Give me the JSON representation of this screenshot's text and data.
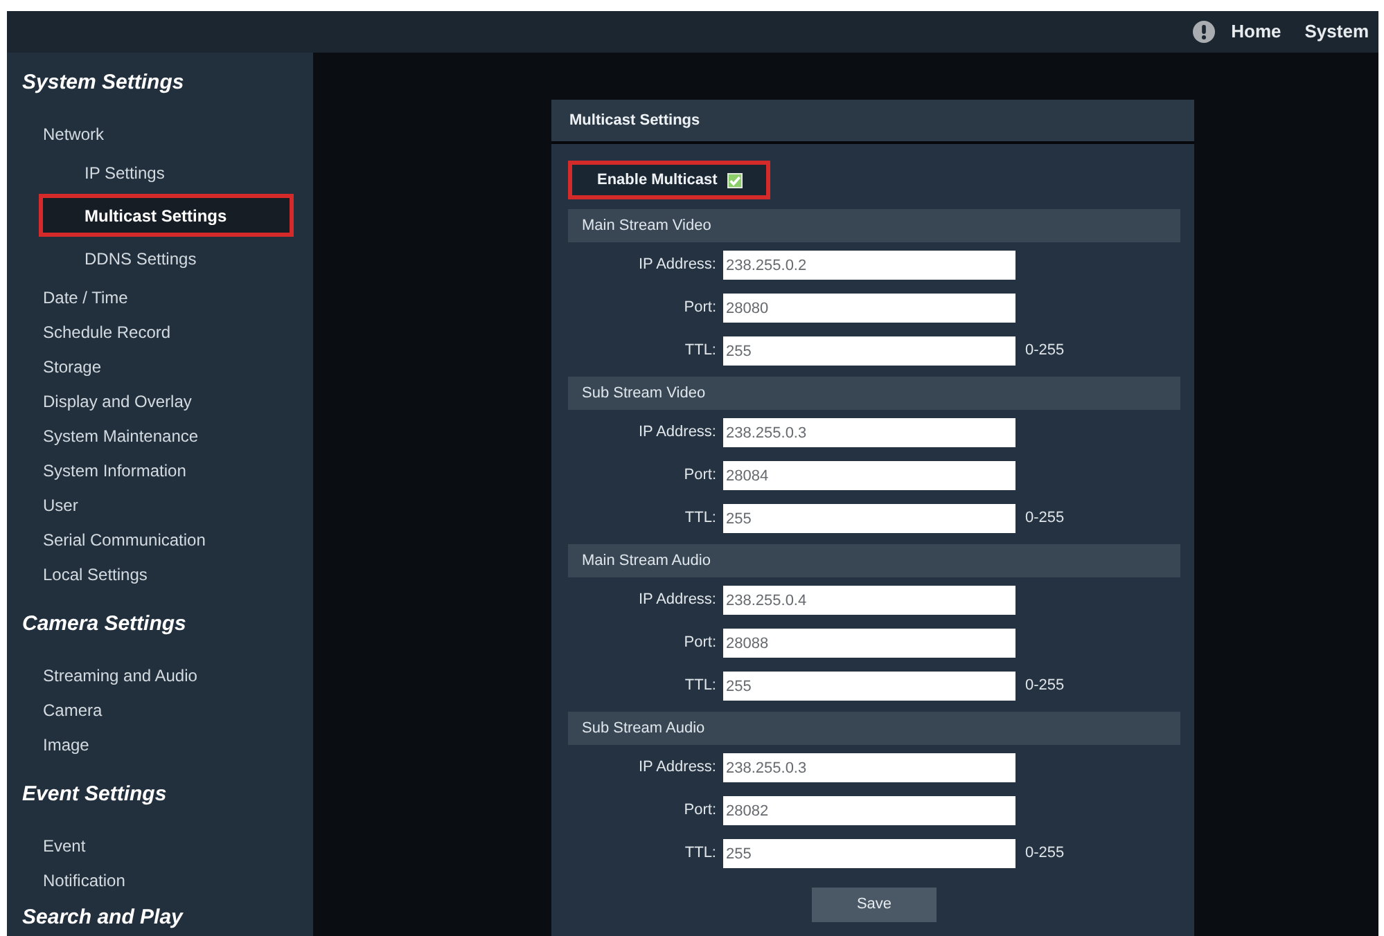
{
  "top_bar": {
    "links": [
      {
        "label": "Home"
      },
      {
        "label": "System"
      }
    ]
  },
  "sidebar": {
    "sections": [
      {
        "title": "System Settings",
        "items": [
          {
            "label": "Network",
            "selected": false,
            "highlighted": false,
            "children": [
              {
                "label": "IP Settings",
                "selected": false,
                "highlighted": false
              },
              {
                "label": "Multicast Settings",
                "selected": true,
                "highlighted": true
              },
              {
                "label": "DDNS Settings",
                "selected": false,
                "highlighted": false
              }
            ]
          },
          {
            "label": "Date / Time",
            "selected": false,
            "highlighted": false
          },
          {
            "label": "Schedule Record",
            "selected": false,
            "highlighted": false
          },
          {
            "label": "Storage",
            "selected": false,
            "highlighted": false
          },
          {
            "label": "Display and Overlay",
            "selected": false,
            "highlighted": false
          },
          {
            "label": "System Maintenance",
            "selected": false,
            "highlighted": false
          },
          {
            "label": "System Information",
            "selected": false,
            "highlighted": false
          },
          {
            "label": "User",
            "selected": false,
            "highlighted": false
          },
          {
            "label": "Serial Communication",
            "selected": false,
            "highlighted": false
          },
          {
            "label": "Local Settings",
            "selected": false,
            "highlighted": false
          }
        ]
      },
      {
        "title": "Camera Settings",
        "items": [
          {
            "label": "Streaming and Audio",
            "selected": false,
            "highlighted": false
          },
          {
            "label": "Camera",
            "selected": false,
            "highlighted": false
          },
          {
            "label": "Image",
            "selected": false,
            "highlighted": false
          }
        ]
      },
      {
        "title": "Event Settings",
        "items": [
          {
            "label": "Event",
            "selected": false,
            "highlighted": false
          },
          {
            "label": "Notification",
            "selected": false,
            "highlighted": false
          }
        ]
      },
      {
        "title": "Search and Play"
      }
    ]
  },
  "panel": {
    "title": "Multicast Settings",
    "enable_multicast": {
      "label": "Enable Multicast",
      "checked": true,
      "highlighted": true
    },
    "groups": [
      {
        "title": "Main Stream Video",
        "fields": [
          {
            "label": "IP Address:",
            "value": "238.255.0.2"
          },
          {
            "label": "Port:",
            "value": "28080"
          },
          {
            "label": "TTL:",
            "value": "255",
            "hint": "0-255"
          }
        ]
      },
      {
        "title": "Sub Stream Video",
        "fields": [
          {
            "label": "IP Address:",
            "value": "238.255.0.3"
          },
          {
            "label": "Port:",
            "value": "28084"
          },
          {
            "label": "TTL:",
            "value": "255",
            "hint": "0-255"
          }
        ]
      },
      {
        "title": "Main Stream Audio",
        "fields": [
          {
            "label": "IP Address:",
            "value": "238.255.0.4"
          },
          {
            "label": "Port:",
            "value": "28088"
          },
          {
            "label": "TTL:",
            "value": "255",
            "hint": "0-255"
          }
        ]
      },
      {
        "title": "Sub Stream Audio",
        "fields": [
          {
            "label": "IP Address:",
            "value": "238.255.0.3"
          },
          {
            "label": "Port:",
            "value": "28082"
          },
          {
            "label": "TTL:",
            "value": "255",
            "hint": "0-255"
          }
        ]
      }
    ],
    "save_button": "Save"
  }
}
